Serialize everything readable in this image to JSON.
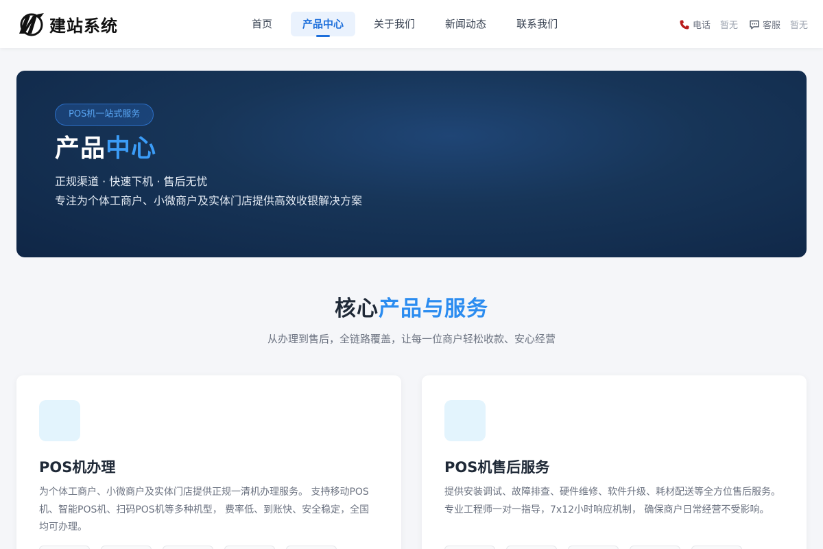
{
  "header": {
    "logo_text": "建站系统",
    "nav": [
      {
        "label": "首页",
        "active": false
      },
      {
        "label": "产品中心",
        "active": true
      },
      {
        "label": "关于我们",
        "active": false
      },
      {
        "label": "新闻动态",
        "active": false
      },
      {
        "label": "联系我们",
        "active": false
      }
    ],
    "phone": {
      "label": "电话",
      "value": "暂无",
      "icon": "phone-icon"
    },
    "service": {
      "label": "客服",
      "value": "暂无",
      "icon": "chat-icon"
    }
  },
  "hero": {
    "badge": "POS机一站式服务",
    "title_main": "产品",
    "title_highlight": "中心",
    "line1": "正规渠道 · 快速下机 · 售后无忧",
    "line2": "专注为个体工商户、小微商户及实体门店提供高效收银解决方案"
  },
  "section": {
    "title_main": "核心",
    "title_highlight": "产品与服务",
    "subtitle": "从办理到售后，全链路覆盖，让每一位商户轻松收款、安心经营"
  },
  "cards": [
    {
      "title": "POS机办理",
      "desc": "为个体工商户、小微商户及实体门店提供正规一清机办理服务。 支持移动POS机、智能POS机、扫码POS机等多种机型， 费率低、到账快、安全稳定，全国均可办理。"
    },
    {
      "title": "POS机售后服务",
      "desc": "提供安装调试、故障排查、硬件维修、软件升级、耗材配送等全方位售后服务。 专业工程师一对一指导，7x12小时响应机制， 确保商户日常经营不受影响。"
    }
  ],
  "colors": {
    "accent": "#2b8cf0",
    "nav_active_bg": "#eaf2fd",
    "hero_bg": "#173558"
  }
}
